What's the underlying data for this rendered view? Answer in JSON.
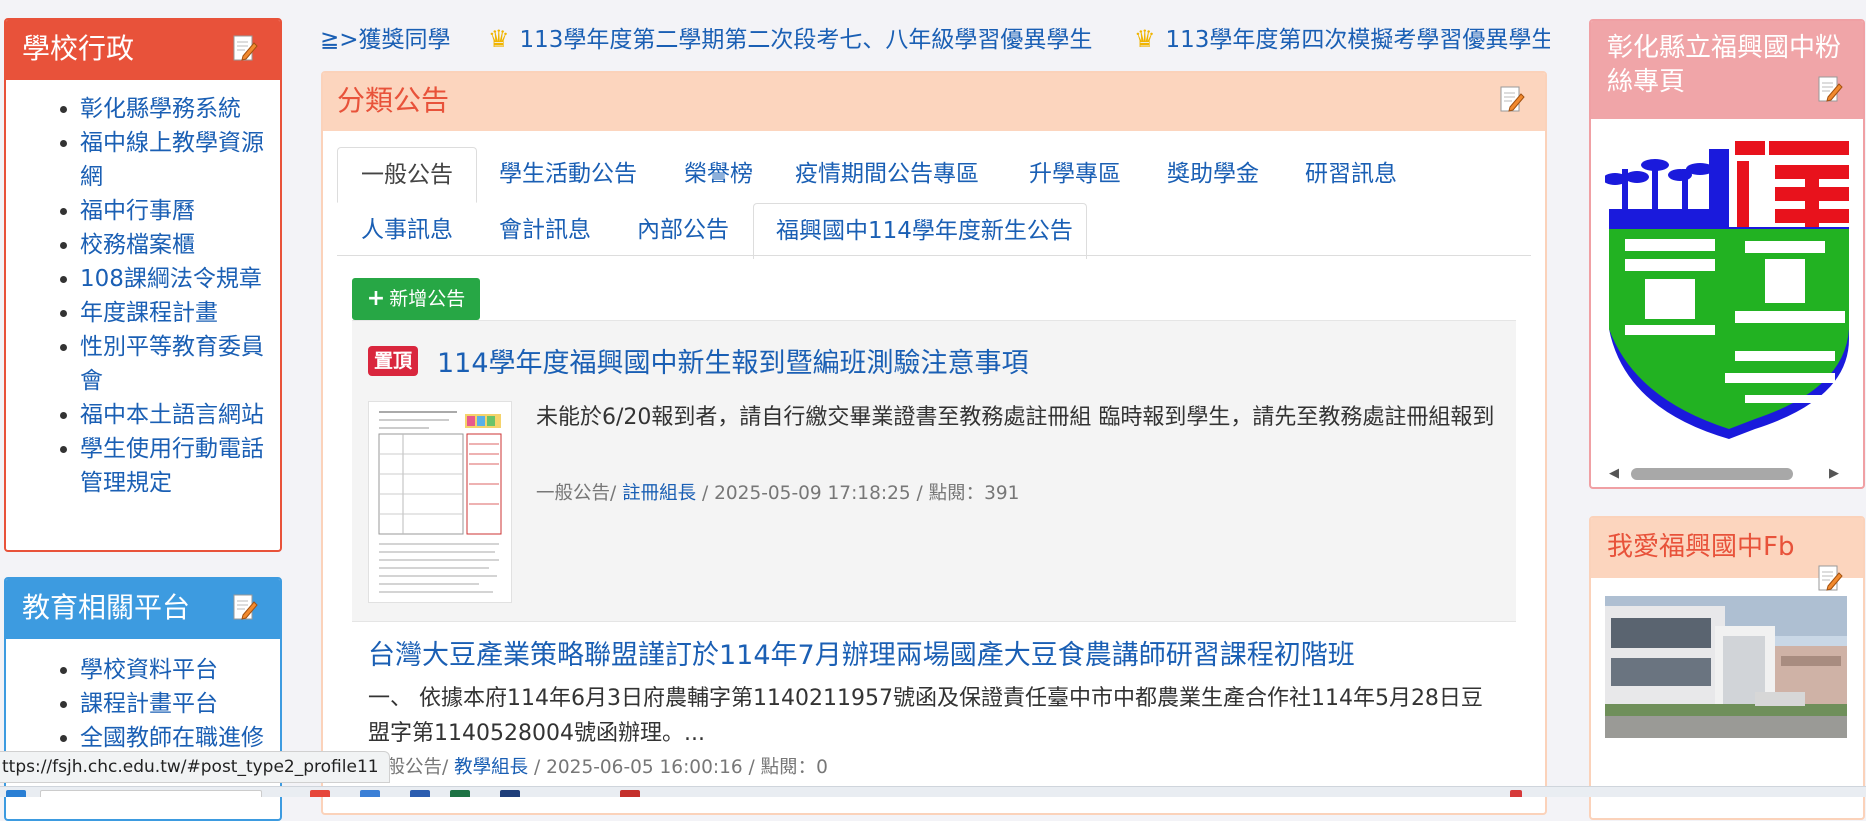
{
  "left": {
    "admin_panel": {
      "title": "學校行政",
      "items": [
        "彰化縣學務系統",
        "福中線上教學資源網",
        "福中行事曆",
        "校務檔案櫃",
        "108課綱法令規章",
        "年度課程計畫",
        "性別平等教育委員會",
        "福中本土語言網站",
        "學生使用行動電話管理規定"
      ]
    },
    "edu_panel": {
      "title": "教育相關平台",
      "items": [
        "學校資料平台",
        "課程計畫平台",
        "全國教師在職進修"
      ]
    }
  },
  "marquee": {
    "items": [
      "≧>獲獎同學",
      "113學年度第二學期第二次段考七、八年級學習優異學生",
      "113學年度第四次模擬考學習優異學生"
    ]
  },
  "main": {
    "title": "分類公告",
    "tabs": [
      "一般公告",
      "學生活動公告",
      "榮譽榜",
      "疫情期間公告專區",
      "升學專區",
      "獎助學金",
      "研習訊息",
      "人事訊息",
      "會計訊息",
      "內部公告",
      "福興國中114學年度新生公告"
    ],
    "active_tab": "一般公告",
    "add_button": "新增公告",
    "posts": [
      {
        "pinned": true,
        "badge": "置頂",
        "title": "114學年度福興國中新生報到暨編班測驗注意事項",
        "excerpt": "未能於6/20報到者，請自行繳交畢業證書至教務處註冊組 臨時報到學生，請先至教務處註冊組報到",
        "category": "一般公告/",
        "author": "註冊組長",
        "datetime": "/ 2025-05-09 17:18:25 / 點閱：391"
      },
      {
        "pinned": false,
        "title": "台灣大豆產業策略聯盟謹訂於114年7月辦理兩場國產大豆食農講師研習課程初階班",
        "excerpt": "一、 依據本府114年6月3日府農輔字第1140211957號函及保證責任臺中市中都農業生產合作社114年5月28日豆盟字第1140528004號函辦理。...",
        "category": "一般公告/",
        "author": "教學組長",
        "datetime": "/ 2025-06-05 16:00:16 / 點閱：0"
      }
    ]
  },
  "right": {
    "fans_panel": {
      "title": "彰化縣立福興國中粉絲專頁"
    },
    "fb_panel": {
      "title": "我愛福興國中Fb"
    }
  },
  "status_url": "ttps://fsjh.chc.edu.tw/#post_type2_profile11",
  "colors": {
    "accent_red": "#e8523a",
    "accent_blue": "#3d9be0",
    "link": "#1a5fb4",
    "add_green": "#27a745",
    "badge_red": "#d9263d",
    "peach": "#fcd5be",
    "pink": "#f0a5a8"
  }
}
